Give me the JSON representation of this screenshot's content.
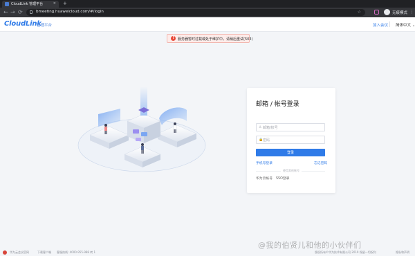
{
  "browser": {
    "tab_title": "CloudLink 管理平台",
    "tab_close": "×",
    "new_tab": "+",
    "url": "bmeeting.huaweicloud.com/#/login",
    "profile_label": "无痕模式",
    "back": "←",
    "forward": "→",
    "reload": "⟳",
    "star": "☆",
    "menu": "⋮"
  },
  "header": {
    "logo": "CloudLink",
    "logo_sub": "管理平台",
    "join_meeting": "加入会议",
    "language": "简体中文 ⌄"
  },
  "alert": {
    "icon": "!",
    "text": "服务器暂时过载或处于维护中，请稍后重试(503)"
  },
  "login": {
    "title": "邮箱 / 帐号登录",
    "username_placeholder": "邮箱/帐号",
    "password_placeholder": "密码",
    "submit": "登录",
    "phone_login": "手机号登录",
    "forgot_password": "忘记密码",
    "other_methods": "使用其他帐号",
    "huawei_account": "华为云帐号",
    "sso_login": "SSO登录",
    "user_icon": "♙",
    "lock_icon": "🔒"
  },
  "footer": {
    "items": [
      "华为云会议官网",
      "下载客户端",
      "客服热线: 4000-955-988 转 1"
    ],
    "copyright": "版权所有©华为技术有限公司 2019 保留一切权利",
    "privacy": "隐私和声明"
  },
  "watermark": "@我的伯贤儿和他的小伙伴们",
  "colors": {
    "accent": "#2f7be8",
    "alert_bg": "#fdecea",
    "alert_icon": "#e84b3a"
  }
}
